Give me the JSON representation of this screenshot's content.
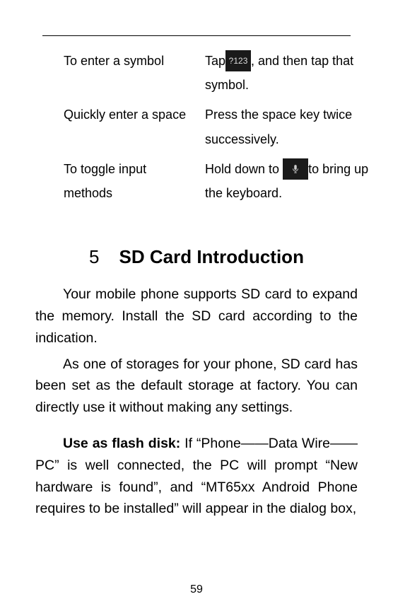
{
  "table": {
    "rows": [
      {
        "left": "To enter a symbol",
        "right_pre_icon": "Tap",
        "icon_name": "symbol-key-icon",
        "icon_label": "?123",
        "right_post_icon": ", and then tap that symbol."
      },
      {
        "left": "Quickly enter a space",
        "right": "Press the space key twice successively."
      },
      {
        "left": "To toggle input methods",
        "right_pre_icon": "Hold down to ",
        "icon_name": "mic-key-icon",
        "right_post_icon": "to bring up the keyboard."
      }
    ]
  },
  "section": {
    "number": "5",
    "title": "SD Card Introduction"
  },
  "paragraphs": {
    "p1": "Your mobile phone supports SD card to expand the memory. Install the SD card according to the indication.",
    "p2": "As one of storages for your phone, SD card has been set as the default storage at factory. You can directly use it without making any settings.",
    "p3_bold": "Use as flash disk:",
    "p3_rest": " If “Phone——Data Wire——PC” is well connected, the PC will prompt “New hardware is found”, and “MT65xx Android Phone requires to be installed” will appear in the dialog box,"
  },
  "page_number": "59"
}
